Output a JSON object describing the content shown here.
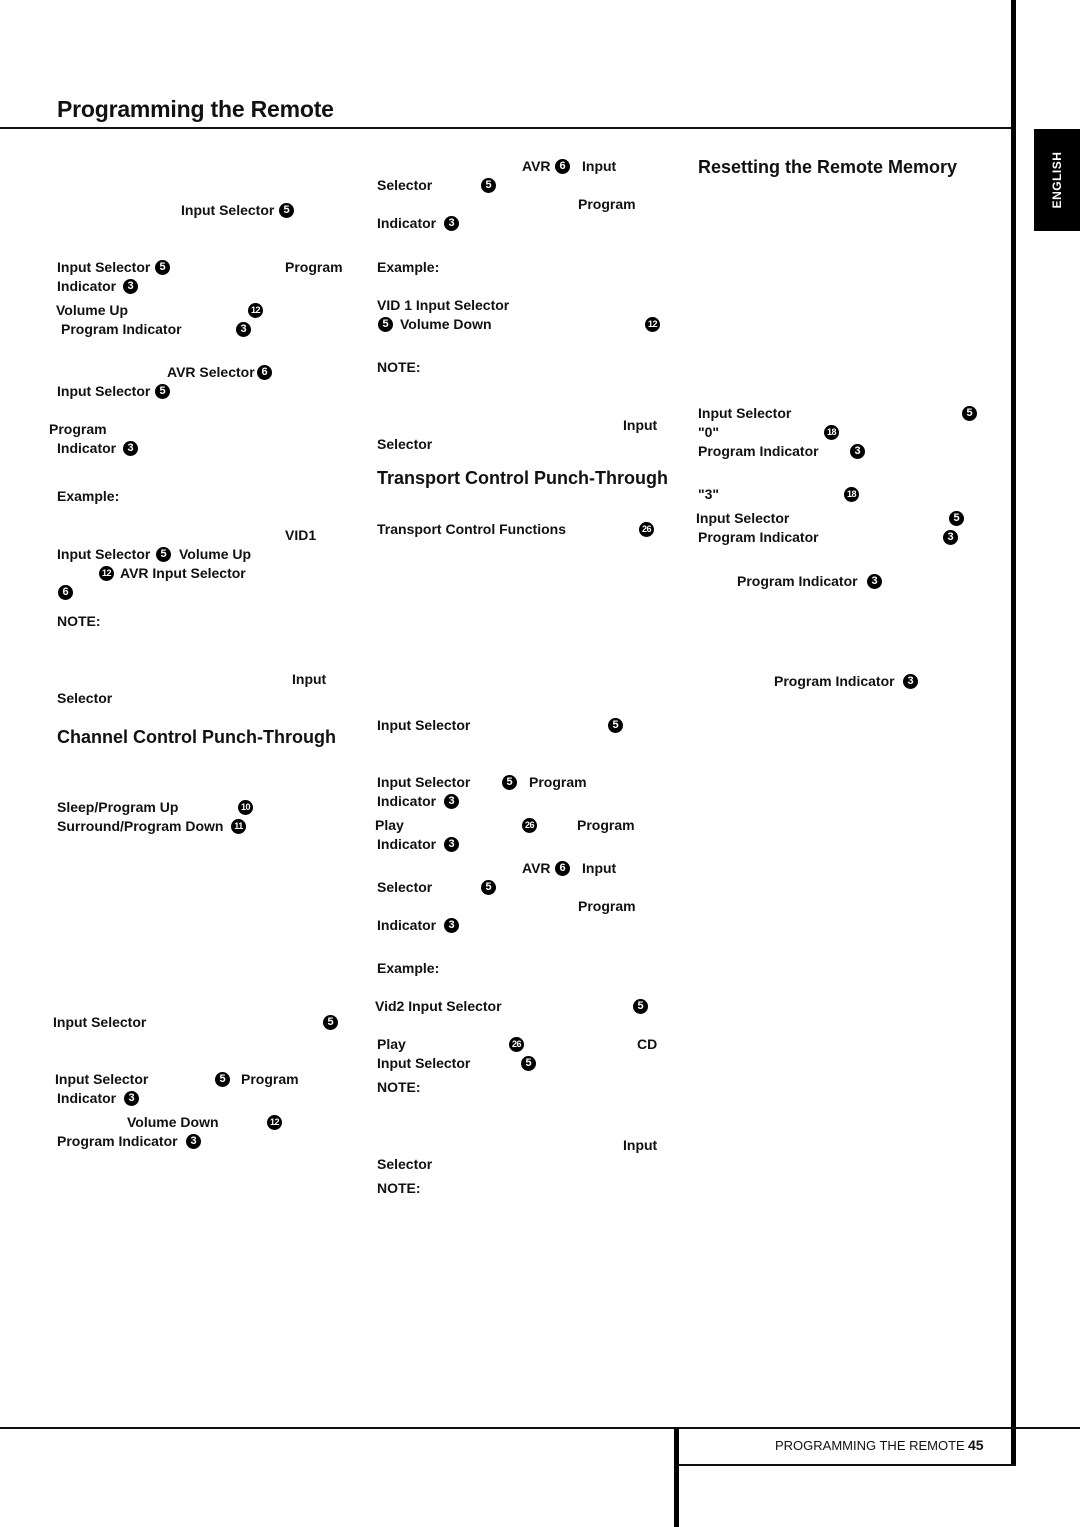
{
  "page": {
    "title": "Programming the Remote",
    "language_tab": "ENGLISH",
    "footer_label": "PROGRAMMING THE REMOTE",
    "page_number": "45"
  },
  "col1": {
    "frags": [
      "Input Selector",
      "5",
      "Input Selector",
      "5",
      "Program",
      "Indicator",
      "3",
      "Volume Up",
      "12",
      "Program Indicator",
      "3",
      "AVR Selector",
      "6",
      "Input Selector",
      "5",
      "Program",
      "Indicator",
      "3",
      "Example:",
      "VID1",
      "Input Selector",
      "5",
      "Volume Up",
      "12",
      "AVR Input Selector",
      "6",
      "NOTE:",
      "Input",
      "Selector",
      "Sleep/Program Up",
      "10",
      "Surround/Program Down",
      "11",
      "Input Selector",
      "5",
      "Input Selector",
      "5",
      "Program",
      "Indicator",
      "3",
      "Volume Down",
      "12",
      "Program Indicator",
      "3"
    ],
    "heading": "Channel Control Punch-Through"
  },
  "col2": {
    "frags": [
      "AVR",
      "6",
      "Input",
      "Selector",
      "5",
      "Program",
      "Indicator",
      "3",
      "Example:",
      "VID 1 Input Selector",
      "5",
      "Volume Down",
      "12",
      "NOTE:",
      "Input",
      "Selector",
      "Transport Control Functions",
      "26",
      "Input Selector",
      "5",
      "Input Selector",
      "5",
      "Program",
      "Indicator",
      "3",
      "Play",
      "26",
      "Program",
      "Indicator",
      "3",
      "AVR",
      "6",
      "Input",
      "Selector",
      "5",
      "Program",
      "Indicator",
      "3",
      "Example:",
      "Vid2 Input Selector",
      "5",
      "Play",
      "26",
      "CD",
      "Input Selector",
      "5",
      "NOTE:",
      "Input",
      "Selector",
      "NOTE:"
    ],
    "heading": "Transport Control Punch-Through"
  },
  "col3": {
    "heading": "Resetting the Remote Memory",
    "frags": [
      "Input Selector",
      "5",
      "\"0\"",
      "18",
      "Program Indicator",
      "3",
      "\"3\"",
      "18",
      "Input Selector",
      "5",
      "Program Indicator",
      "3",
      "Program Indicator",
      "3",
      "Program Indicator",
      "3"
    ]
  }
}
